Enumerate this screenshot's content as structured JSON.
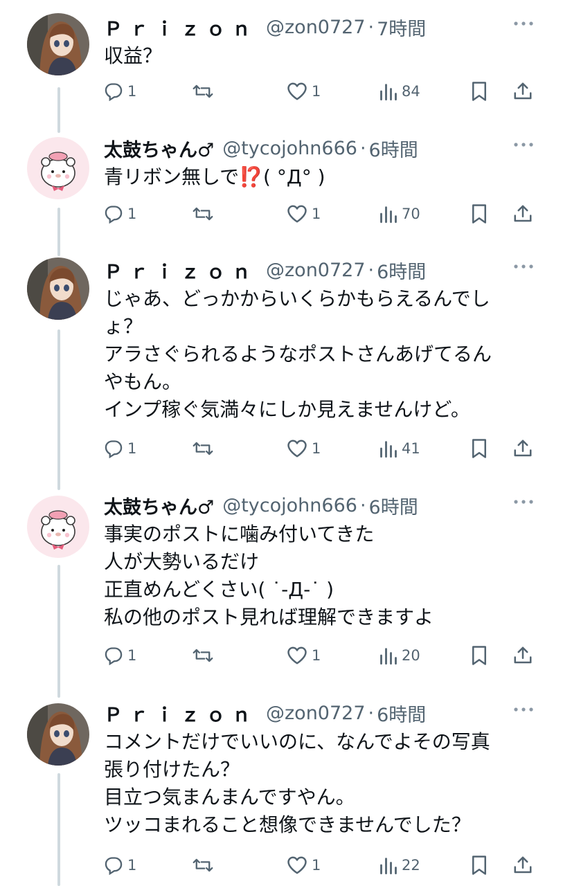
{
  "colors": {
    "text": "#0f1419",
    "secondary": "#536471",
    "thread_line": "#cfd9de",
    "alert_emoji": "#e0245e"
  },
  "icons": {
    "reply": "reply-icon",
    "retweet": "retweet-icon",
    "like": "like-icon",
    "views": "views-icon",
    "bookmark": "bookmark-icon",
    "share": "share-icon",
    "more": "more-icon"
  },
  "tweets": [
    {
      "name": "Ｐｒｉｚｏｎ",
      "handle": "@zon0727",
      "dot": "·",
      "time": "7時間",
      "lines": [
        "収益？"
      ],
      "replies": "1",
      "likes": "1",
      "views": "84"
    },
    {
      "name": "太鼓ちゃん♂",
      "handle": "@tycojohn666",
      "dot": "·",
      "time": "6時間",
      "line_before_emoji": "青リボン無しで",
      "emoji": "⁉️",
      "line_after_emoji": "( °Д° )",
      "replies": "1",
      "likes": "1",
      "views": "70"
    },
    {
      "name": "Ｐｒｉｚｏｎ",
      "handle": "@zon0727",
      "dot": "·",
      "time": "6時間",
      "lines": [
        "じゃあ、どっかからいくらかもらえるんでし",
        "ょ？",
        "アラさぐられるようなポストさんあげてるん",
        "やもん。",
        "インプ稼ぐ気満々にしか見えませんけど。"
      ],
      "replies": "1",
      "likes": "1",
      "views": "41"
    },
    {
      "name": "太鼓ちゃん♂",
      "handle": "@tycojohn666",
      "dot": "·",
      "time": "6時間",
      "lines": [
        "事実のポストに噛み付いてきた",
        "人が大勢いるだけ",
        "正直めんどくさい( ˙-Д-˙ )",
        "私の他のポスト見れば理解できますよ"
      ],
      "replies": "1",
      "likes": "1",
      "views": "20"
    },
    {
      "name": "Ｐｒｉｚｏｎ",
      "handle": "@zon0727",
      "dot": "·",
      "time": "6時間",
      "lines": [
        "コメントだけでいいのに、なんでよその写真",
        "張り付けたん？",
        "目立つ気まんまんですやん。",
        "ツッコまれること想像できませんでした？"
      ],
      "replies": "1",
      "likes": "1",
      "views": "22"
    }
  ]
}
